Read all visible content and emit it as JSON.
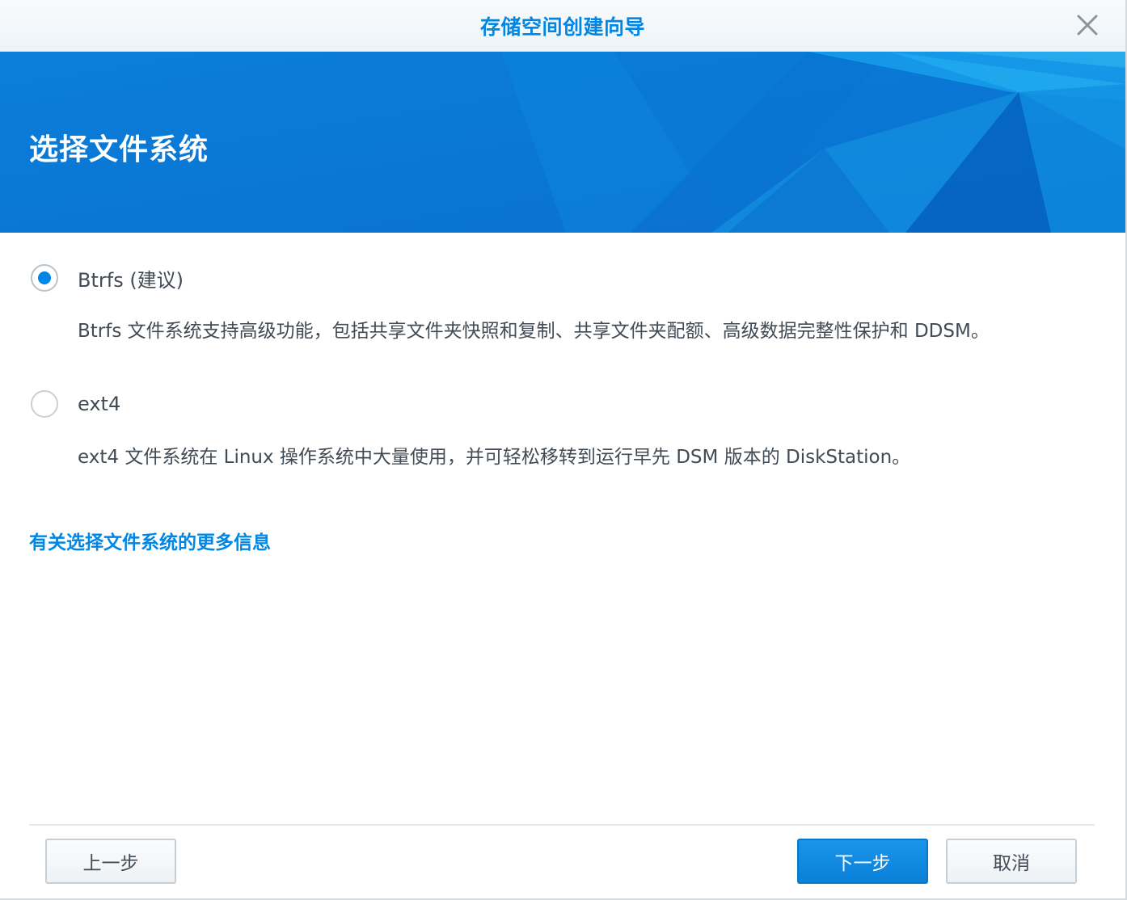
{
  "window": {
    "title": "存储空间创建向导"
  },
  "banner": {
    "title": "选择文件系统"
  },
  "options": [
    {
      "label": "Btrfs (建议)",
      "selected": true,
      "description": "Btrfs 文件系统支持高级功能，包括共享文件夹快照和复制、共享文件夹配额、高级数据完整性保护和 DDSM。"
    },
    {
      "label": "ext4",
      "selected": false,
      "description": "ext4 文件系统在 Linux 操作系统中大量使用，并可轻松移转到运行早先 DSM 版本的 DiskStation。"
    }
  ],
  "more_info_link": "有关选择文件系统的更多信息",
  "footer": {
    "back_label": "上一步",
    "next_label": "下一步",
    "cancel_label": "取消"
  },
  "colors": {
    "accent": "#0086e5",
    "banner": "#0a7fd9",
    "text": "#414b55"
  },
  "icons": {
    "close": "close-icon"
  }
}
